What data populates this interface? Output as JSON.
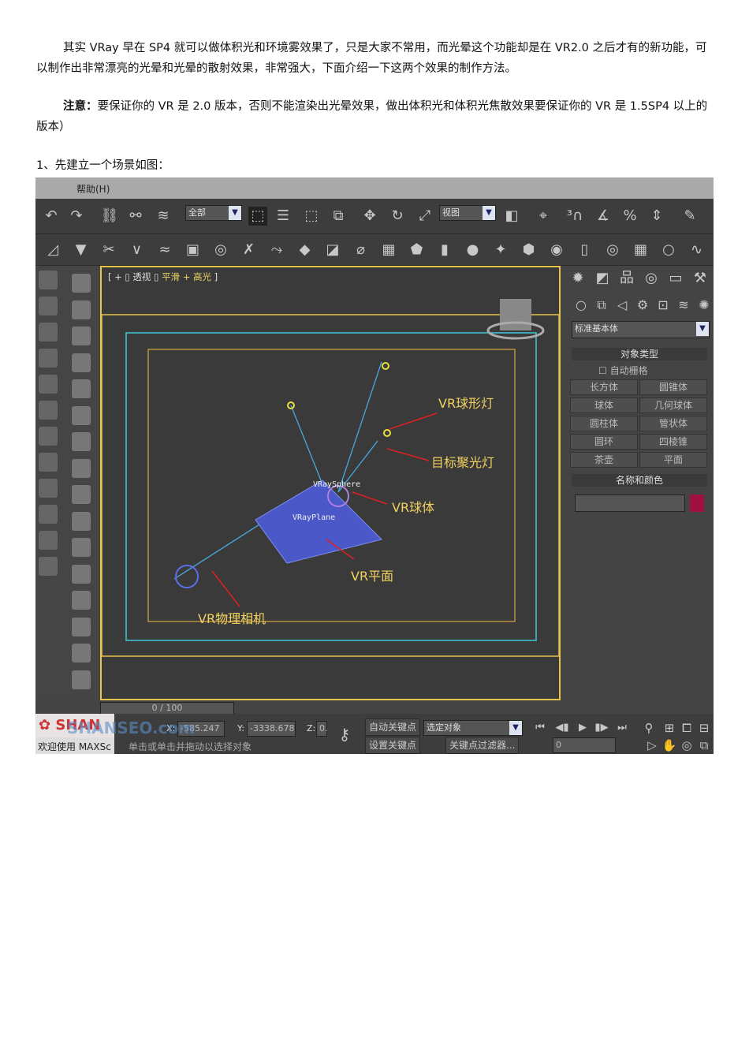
{
  "doc": {
    "para1": "其实 VRay 早在 SP4 就可以做体积光和环境雾效果了，只是大家不常用，而光晕这个功能却是在 VR2.0 之后才有的新功能，可以制作出非常漂亮的光晕和光晕的散射效果，非常强大，下面介绍一下这两个效果的制作方法。",
    "note_label": "注意：",
    "note_text": "要保证你的 VR 是 2.0 版本，否则不能渲染出光晕效果，做出体积光和体积光焦散效果要保证你的 VR 是 1.5SP4 以上的版本）",
    "step1": "1、先建立一个场景如图："
  },
  "app": {
    "menu_help": "帮助(H)",
    "selection_filter": "全部",
    "ref_coord": "视图",
    "viewport_label": {
      "prefix": "[ + ▯ ",
      "view": "透视",
      "sep": " ▯ ",
      "shade": "平滑 + 高光",
      "suffix": " ]"
    },
    "scene_labels": {
      "sphere_light": "VR球形灯",
      "spot": "目标聚光灯",
      "sphere": "VR球体",
      "plane": "VR平面",
      "camera": "VR物理相机",
      "sphere_obj": "VRaySphere",
      "plane_obj": "VRayPlane"
    },
    "panel": {
      "category": "标准基本体",
      "object_type": "对象类型",
      "autogrid": "自动栅格",
      "buttons": [
        "长方体",
        "圆锥体",
        "球体",
        "几何球体",
        "圆柱体",
        "管状体",
        "圆环",
        "四棱锥",
        "茶壶",
        "平面"
      ],
      "name_color": "名称和颜色",
      "color": "#a01040"
    },
    "timeline": "0 / 100",
    "status": {
      "welcome": "欢迎使用 MAXSc",
      "prompt": "单击或单击并拖动以选择对象",
      "x_label": "X:",
      "x": "-585.247",
      "y_label": "Y:",
      "y": "-3338.678",
      "z_label": "Z:",
      "z": "0.",
      "auto_key": "自动关键点",
      "set_key": "设置关键点",
      "key_mode": "选定对象",
      "key_filters": "关键点过滤器...",
      "frame": "0"
    },
    "watermark": "SHANSEO.com"
  }
}
